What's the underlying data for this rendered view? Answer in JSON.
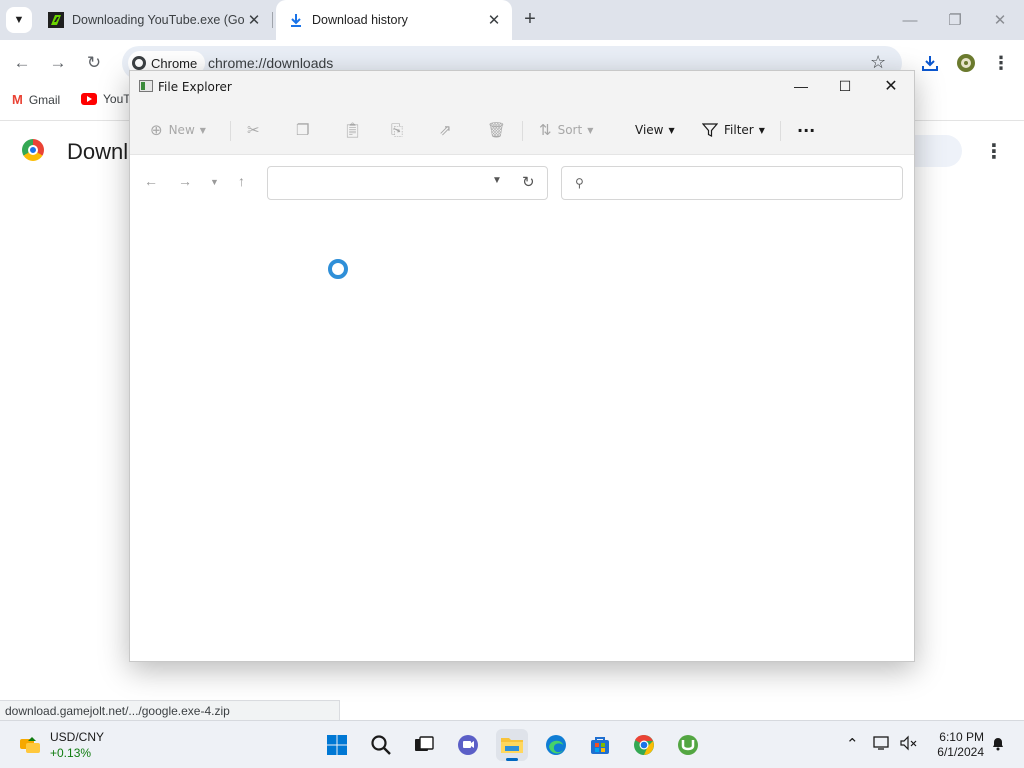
{
  "browser": {
    "tabs": [
      {
        "title": "Downloading YouTube.exe (Go",
        "active": false
      },
      {
        "title": "Download history",
        "active": true
      }
    ],
    "omnibox": {
      "chip_label": "Chrome",
      "url": "chrome://downloads"
    },
    "bookmarks": [
      {
        "label": "Gmail"
      },
      {
        "label": "YouTu"
      }
    ],
    "page": {
      "heading": "Downl"
    },
    "status_url": "download.gamejolt.net/.../google.exe-4.zip"
  },
  "explorer": {
    "title": "File Explorer",
    "commands": {
      "new": "New",
      "sort": "Sort",
      "view": "View",
      "filter": "Filter",
      "more": "···"
    }
  },
  "taskbar": {
    "ticker": {
      "name": "USD/CNY",
      "change": "+0.13%"
    },
    "clock": {
      "time": "6:10 PM",
      "date": "6/1/2024"
    }
  },
  "colors": {
    "accent": "#0067c0",
    "tabstrip": "#dfe3eb",
    "omnibox": "#e9eef6",
    "ticker_up": "#107c10",
    "spinner": "#2f8fd8"
  }
}
